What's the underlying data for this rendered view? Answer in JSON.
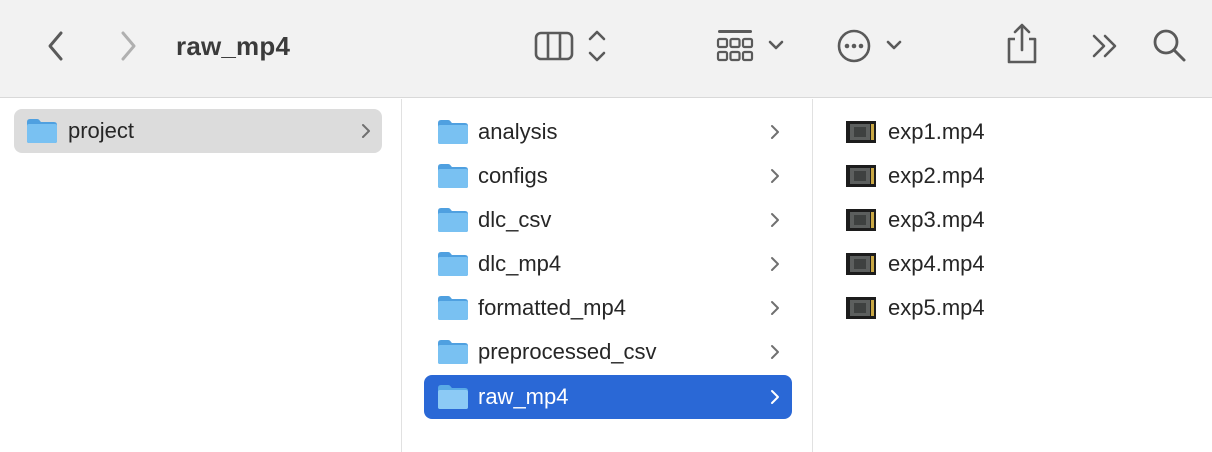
{
  "window": {
    "title": "raw_mp4"
  },
  "toolbar": {
    "back_icon": "chevron-left-icon",
    "forward_icon": "chevron-right-icon",
    "view_icon": "column-view-icon",
    "group_icon": "grid-group-icon",
    "more_icon": "ellipsis-circle-icon",
    "share_icon": "share-icon",
    "overflow_icon": "double-chevron-icon",
    "search_icon": "search-icon"
  },
  "colors": {
    "selection_active": "#2a68d6",
    "selection_inactive": "#dcdcdc",
    "folder_blue": "#6cb4ec"
  },
  "column1": {
    "items": [
      {
        "label": "project",
        "selected": "inactive"
      }
    ]
  },
  "column2": {
    "items": [
      {
        "label": "analysis"
      },
      {
        "label": "configs"
      },
      {
        "label": "dlc_csv"
      },
      {
        "label": "dlc_mp4"
      },
      {
        "label": "formatted_mp4"
      },
      {
        "label": "preprocessed_csv"
      },
      {
        "label": "raw_mp4",
        "selected": "active"
      }
    ]
  },
  "column3": {
    "items": [
      {
        "label": "exp1.mp4"
      },
      {
        "label": "exp2.mp4"
      },
      {
        "label": "exp3.mp4"
      },
      {
        "label": "exp4.mp4"
      },
      {
        "label": "exp5.mp4"
      }
    ]
  }
}
